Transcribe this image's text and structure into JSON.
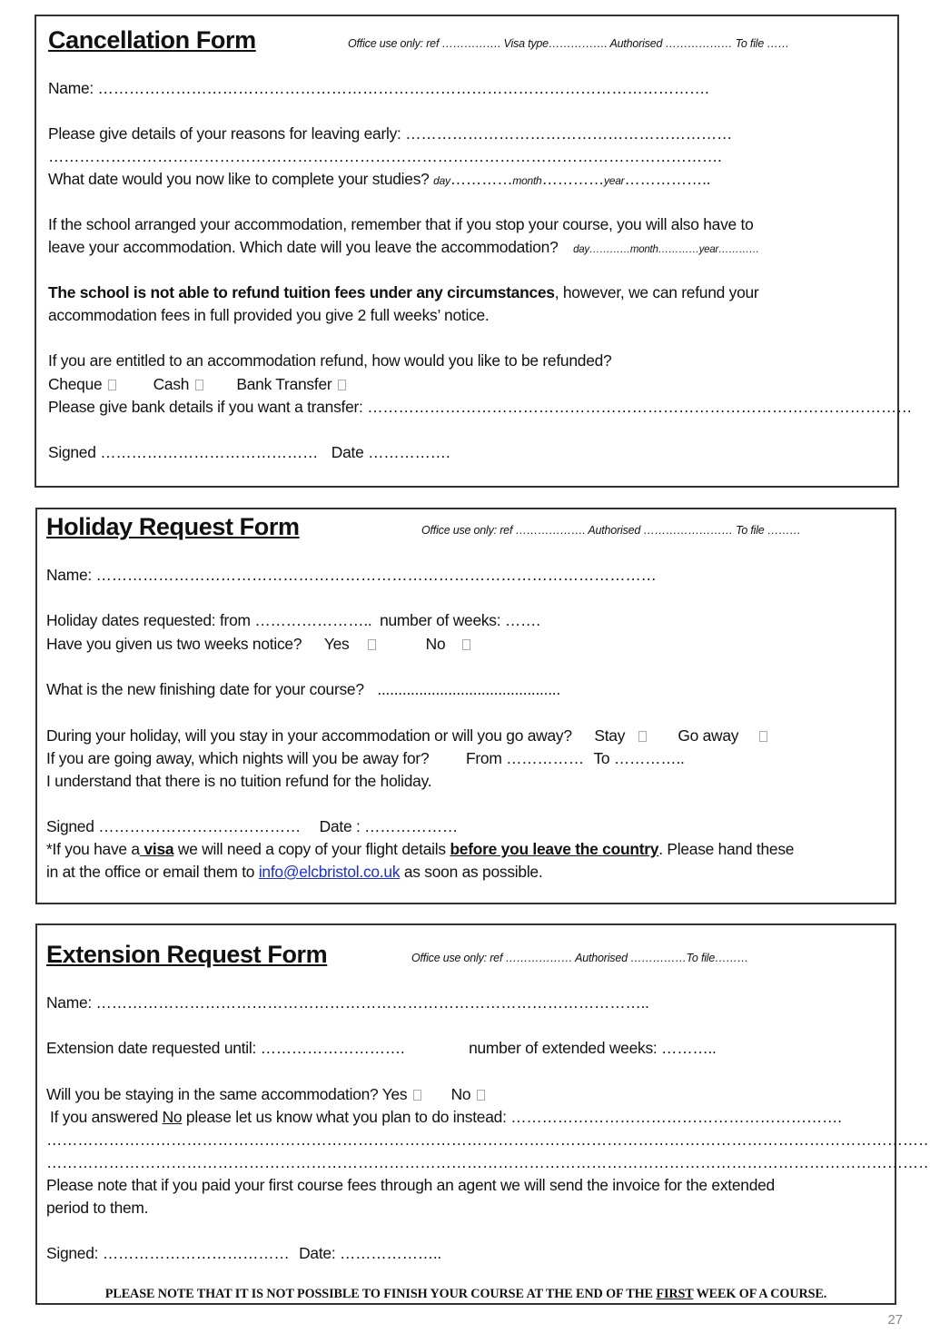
{
  "cancellation": {
    "title": "Cancellation Form",
    "office_use": "Office use only: ref ……………. Visa type……………. Authorised ……………… To file ……",
    "name_label": "Name: ……………………………………………………………………………………………………….",
    "reasons_label": "Please give details of your reasons for leaving early: ………………………………………………………",
    "reasons_continuation": "………………………………………………………………………………………………………………….",
    "complete_date_label": "What date would you now like to complete your studies?",
    "complete_date_day": "day",
    "complete_date_dots1": "…………",
    "complete_date_month": "month",
    "complete_date_dots2": "…………",
    "complete_date_year": "year",
    "complete_date_dots3": "……………..",
    "accommodation_line1": "If the school arranged your accommodation, remember that if you stop your course, you will also have to",
    "accommodation_line2": "leave your accommodation.  Which date will you leave the accommodation?",
    "accommodation_date": "day…………month…………year…………",
    "refund_bold": "The school is not able to refund tuition fees under any circumstances",
    "refund_rest": ", however, we can refund your",
    "refund_line2": "accommodation fees in full provided you give 2 full weeks’ notice.",
    "refund_method_question": "If you are entitled to an accommodation refund, how would you like to be refunded?",
    "options": [
      {
        "label": "Cheque"
      },
      {
        "label": "Cash"
      },
      {
        "label": "Bank Transfer"
      }
    ],
    "bank_details_label": "Please give bank details if you want a transfer: ……………………………………………………………………………………………",
    "signed_label": "Signed ……………………………………",
    "date_label": "Date ……………."
  },
  "holiday": {
    "title": "Holiday Request Form",
    "office_use": "Office use only: ref ………………. Authorised …………………… To file ………",
    "name_label": "Name: ………………………………………………………………………………………………",
    "dates_label": "Holiday dates requested:  from …………………..",
    "weeks_label": "number of weeks: …….",
    "notice_question": "Have you given us two weeks notice?",
    "yes_label": "Yes",
    "no_label": "No",
    "finish_date_label": "What is the new finishing date for your course?",
    "finish_date_dots": "............................................",
    "stay_question": "During your holiday, will you stay in your accommodation or will you go away?",
    "stay_label": "Stay",
    "go_away_label": "Go away",
    "nights_question": "If you are going away, which nights will you be away for?",
    "nights_from": "From ……………",
    "nights_to": "To …………..",
    "no_refund_statement": "I understand that there is no tuition refund for the holiday.",
    "signed_label": "Signed …………………………………",
    "date_label": "Date : ………………",
    "visa_note_pre": "*If you have a",
    "visa_word": " visa",
    "visa_note_mid": " we will need a copy of your flight details ",
    "visa_note_bold": "before you leave the country",
    "visa_note_post": ". Please hand these",
    "visa_note_line2_pre": "in at the office or email them to ",
    "email": "info@elcbristol.co.uk",
    "visa_note_line2_post": " as soon as possible."
  },
  "extension": {
    "title": "Extension Request Form",
    "office_use": "Office use only: ref ……………… Authorised ……………To file………",
    "name_label": "Name: ……………………………………………………………………………………………..",
    "until_label": "Extension date requested until: ……………………….",
    "weeks_label": "number of extended weeks: ………..",
    "accommodation_question": "Will you be staying in the same accommodation? Yes",
    "no_label": "No",
    "answered_no_pre": "If you answered ",
    "answered_no_word": "No",
    "answered_no_post": " please let us know what you plan to do instead: ……………………………………………………….",
    "dots_line1": "…………………………………………………………………………………………………………………………………………………………..",
    "dots_line2": "…………………………………………………………………………………………………………………………………………………………..",
    "agent_note_line1": "Please note that if you paid your first course fees through an agent we will send the invoice for the extended",
    "agent_note_line2": "period to them.",
    "signed_label": "Signed: ………………………………",
    "date_label": "Date: ………………..",
    "footer_pre": "PLEASE NOTE THAT IT IS NOT POSSIBLE TO FINISH YOUR COURSE AT THE END OF THE ",
    "footer_underlined": "FIRST",
    "footer_post": " WEEK OF A COURSE."
  },
  "page_number": "27"
}
